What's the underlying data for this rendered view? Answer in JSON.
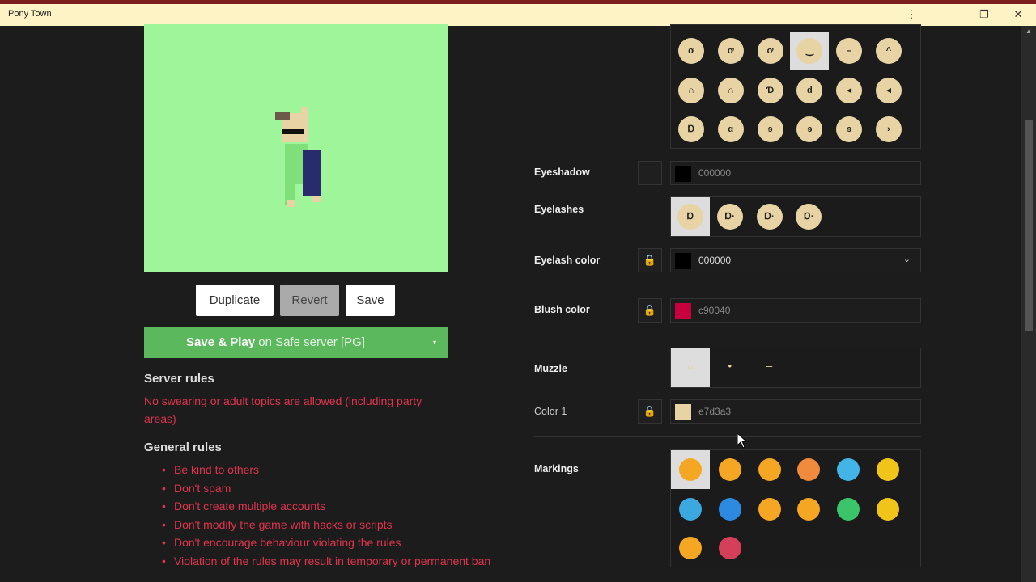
{
  "window": {
    "title": "Pony Town",
    "controls": [
      "⋮",
      "—",
      "❐",
      "✕"
    ]
  },
  "preview": {
    "background": "#9ff59a"
  },
  "buttons": {
    "duplicate": "Duplicate",
    "revert": "Revert",
    "save": "Save"
  },
  "play": {
    "action": "Save & Play",
    "server": "on Safe server [PG]",
    "caret": "▾"
  },
  "server_rules": {
    "heading": "Server rules",
    "text": "No swearing or adult topics are allowed (including party areas)"
  },
  "general_rules": {
    "heading": "General rules",
    "items": [
      "Be kind to others",
      "Don't spam",
      "Don't create multiple accounts",
      "Don't modify the game with hacks or scripts",
      "Don't encourage behaviour violating the rules",
      "Violation of the rules may result in temporary or permanent ban"
    ]
  },
  "eyes_grid": {
    "rows": [
      [
        "ơ",
        "ơ",
        "ơ",
        "‿",
        "–",
        "^"
      ],
      [
        "∩",
        "∩",
        "Ɗ",
        "d",
        "◂",
        "◂"
      ],
      [
        "Ɒ",
        "ɑ",
        "ɘ",
        "ɘ",
        "ɘ",
        "›"
      ]
    ],
    "selected": [
      0,
      3
    ]
  },
  "eyeshadow": {
    "label": "Eyeshadow",
    "color": "#000000",
    "hex": "000000"
  },
  "eyelashes": {
    "label": "Eyelashes",
    "options": [
      "Ɒ",
      "Ɒ·",
      "Ɒ·",
      "Ɒ·"
    ],
    "selected": 0
  },
  "eyelash_color": {
    "label": "Eyelash color",
    "color": "#000000",
    "hex": "000000",
    "lock": "🔒",
    "chevron": "⌄"
  },
  "blush_color": {
    "label": "Blush color",
    "color": "#c90040",
    "hex": "c90040",
    "lock": "🔒"
  },
  "muzzle": {
    "label": "Muzzle",
    "options": [
      "ᴗ",
      "•",
      "–"
    ],
    "selected": 0
  },
  "color1": {
    "label": "Color 1",
    "color": "#e7d3a3",
    "hex": "e7d3a3",
    "lock": "🔒"
  },
  "markings": {
    "label": "Markings",
    "rows": [
      [
        "#f5a623",
        "#f5a623",
        "#f5a623",
        "#f08a3c",
        "#42b4e6",
        "#f0c419"
      ],
      [
        "#3ba9e0",
        "#2c8ae0",
        "#f5a623",
        "#f5a623",
        "#3cc46b",
        "#f0c419"
      ],
      [
        "#f5a623",
        "#d63f5a"
      ]
    ],
    "selected": [
      0,
      0
    ]
  }
}
